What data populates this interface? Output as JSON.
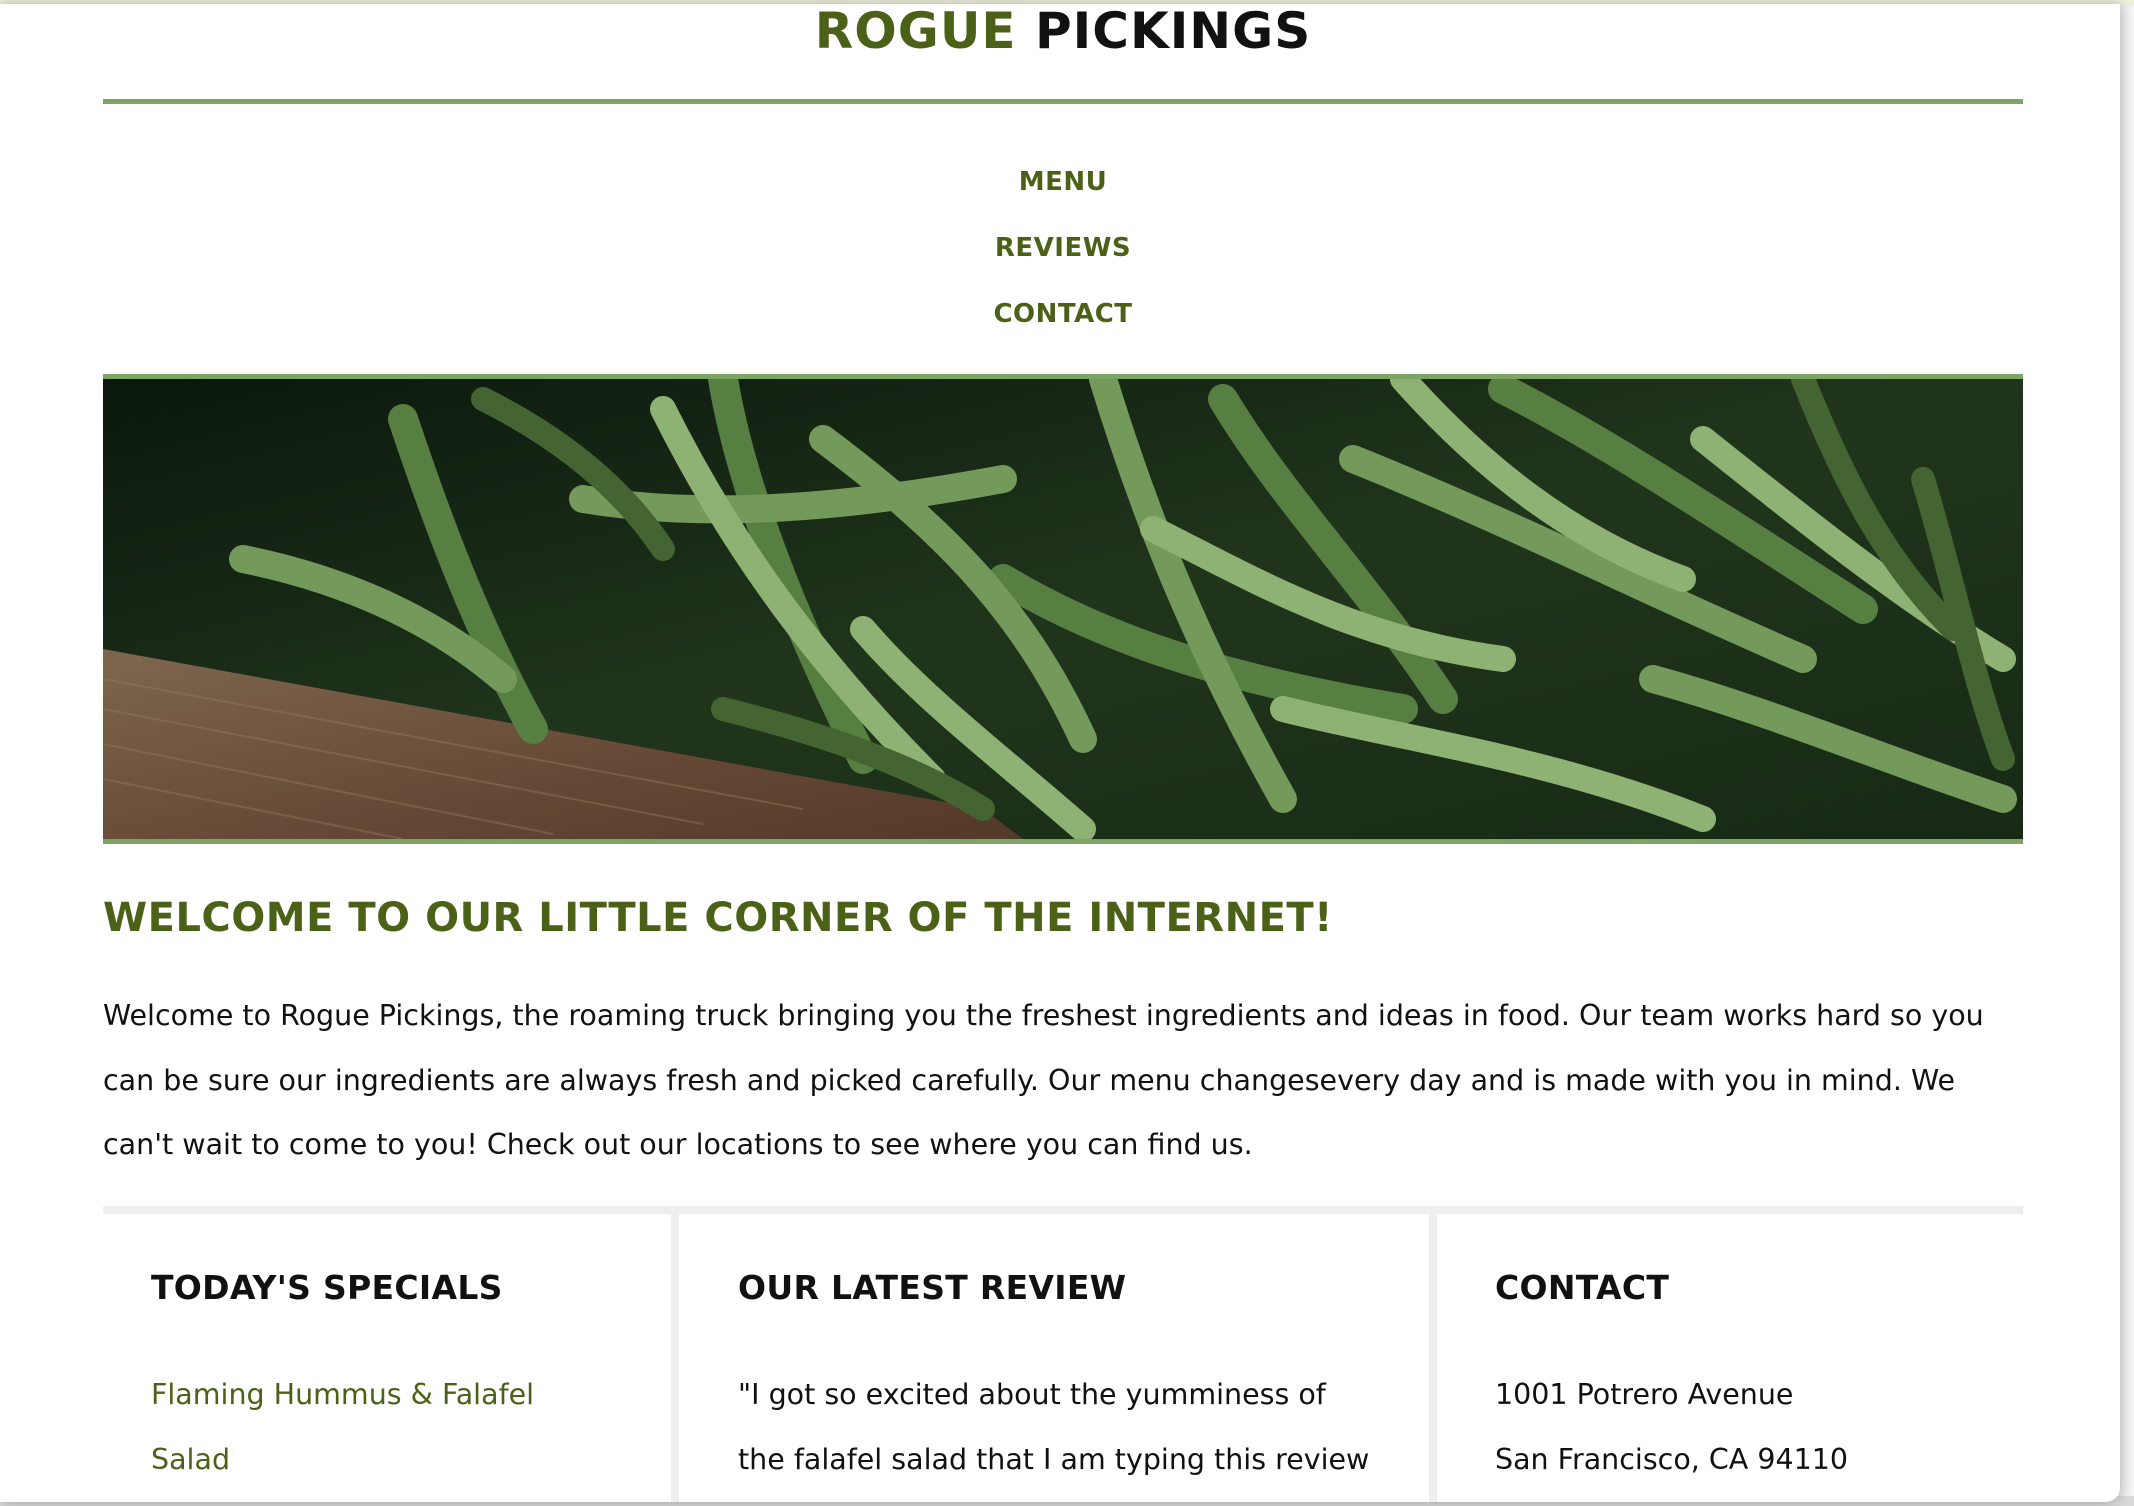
{
  "brand": {
    "word1": "ROGUE",
    "word2": "PICKINGS"
  },
  "nav": {
    "menu": "MENU",
    "reviews": "REVIEWS",
    "contact": "CONTACT"
  },
  "hero": {
    "description": "green beans"
  },
  "welcome": {
    "title": "WELCOME TO OUR LITTLE CORNER OF THE INTERNET!",
    "body": "Welcome to Rogue Pickings, the roaming truck bringing you the freshest ingredients and ideas in food. Our team works hard so you can be sure our ingredients are always fresh and picked carefully. Our menu changesevery day and is made with you in mind. We can't wait to come to you! Check out our locations to see where you can find us."
  },
  "specials": {
    "heading": "TODAY'S SPECIALS",
    "lines": [
      "Flaming Hummus & Falafel",
      "Salad"
    ]
  },
  "review": {
    "heading": "OUR LATEST REVIEW",
    "lines": [
      "\"I got so excited about the yumminess of",
      "the falafel salad that I am typing this review"
    ]
  },
  "contact": {
    "heading": "CONTACT",
    "lines": [
      "1001 Potrero Avenue",
      "San Francisco, CA 94110"
    ]
  },
  "colors": {
    "brand_green": "#4c6118",
    "rule_green": "#7ba465",
    "divider_gray": "#eeeeee",
    "text": "#111111"
  }
}
